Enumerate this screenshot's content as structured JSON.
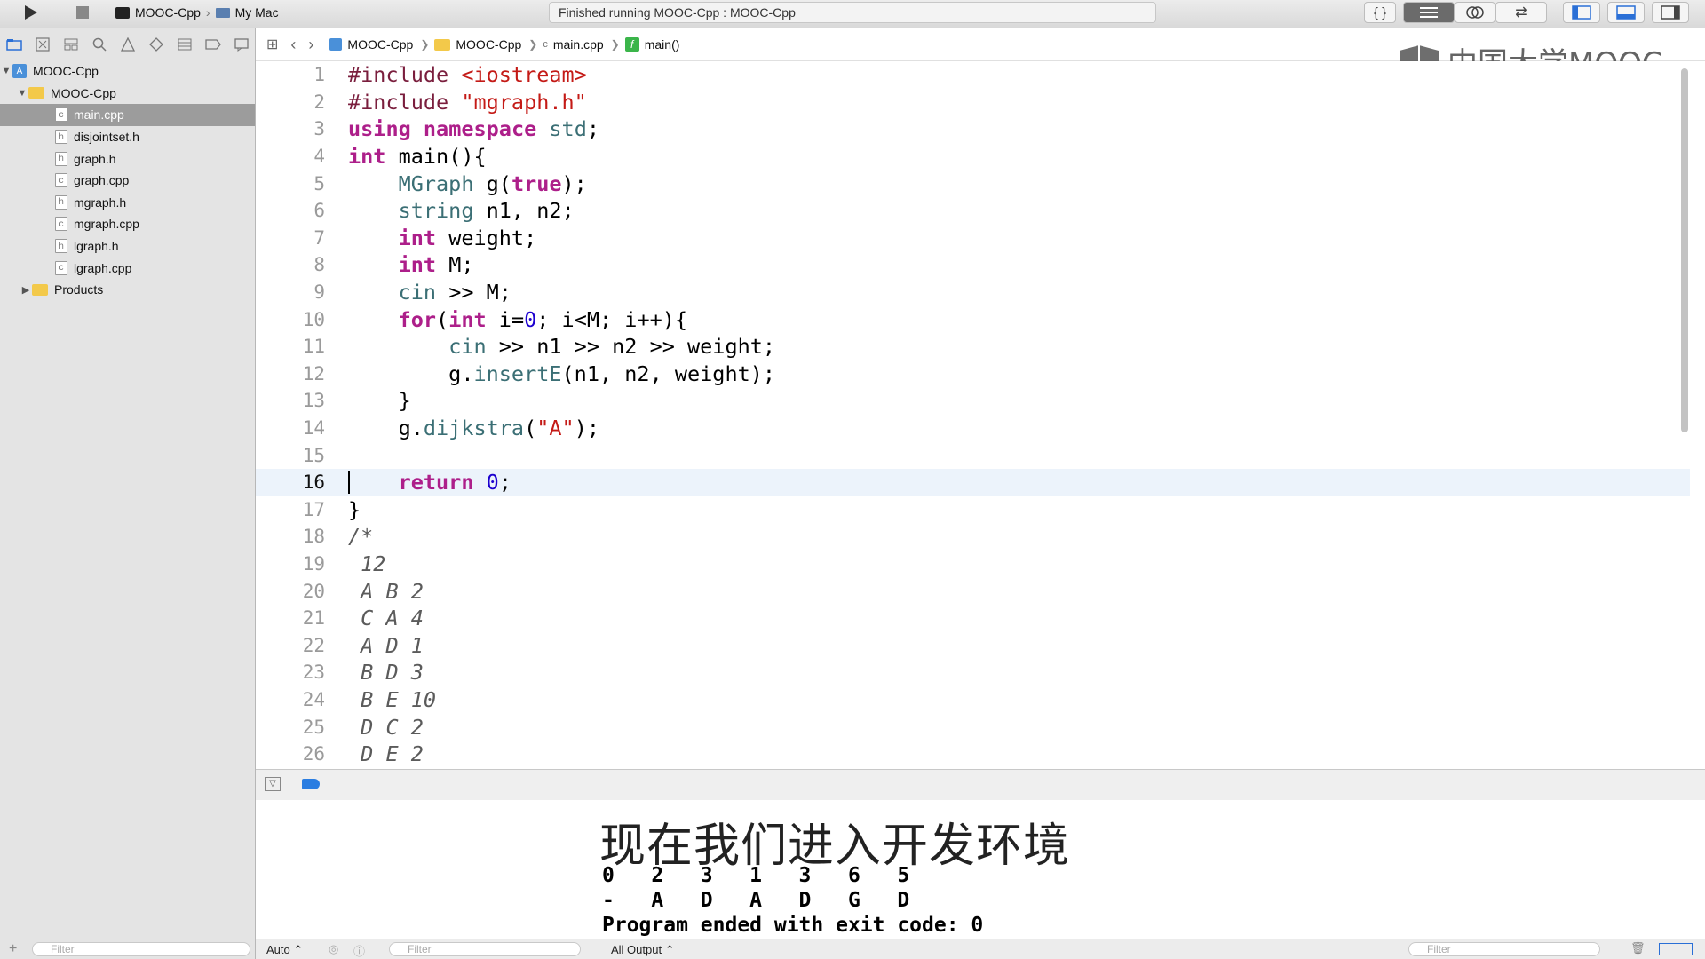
{
  "toolbar": {
    "scheme_target": "MOOC-Cpp",
    "scheme_device": "My Mac",
    "status_text": "Finished running MOOC-Cpp : MOOC-Cpp"
  },
  "watermark": {
    "brand": "中国大学MOOC"
  },
  "navigator": {
    "project": "MOOC-Cpp",
    "group": "MOOC-Cpp",
    "files": [
      {
        "name": "main.cpp",
        "kind": "c",
        "selected": true
      },
      {
        "name": "disjointset.h",
        "kind": "h"
      },
      {
        "name": "graph.h",
        "kind": "h"
      },
      {
        "name": "graph.cpp",
        "kind": "c"
      },
      {
        "name": "mgraph.h",
        "kind": "h"
      },
      {
        "name": "mgraph.cpp",
        "kind": "c"
      },
      {
        "name": "lgraph.h",
        "kind": "h"
      },
      {
        "name": "lgraph.cpp",
        "kind": "c"
      }
    ],
    "products": "Products",
    "filter_placeholder": "Filter"
  },
  "jumpbar": {
    "items": [
      "MOOC-Cpp",
      "MOOC-Cpp",
      "main.cpp",
      "main()"
    ]
  },
  "editor": {
    "current_line": 16,
    "lines": [
      {
        "n": "1",
        "src": "#include <iostream>"
      },
      {
        "n": "2",
        "src": "#include \"mgraph.h\""
      },
      {
        "n": "3",
        "src": "using namespace std;"
      },
      {
        "n": "4",
        "src": "int main(){"
      },
      {
        "n": "5",
        "src": "    MGraph g(true);"
      },
      {
        "n": "6",
        "src": "    string n1, n2;"
      },
      {
        "n": "7",
        "src": "    int weight;"
      },
      {
        "n": "8",
        "src": "    int M;"
      },
      {
        "n": "9",
        "src": "    cin >> M;"
      },
      {
        "n": "10",
        "src": "    for(int i=0; i<M; i++){"
      },
      {
        "n": "11",
        "src": "        cin >> n1 >> n2 >> weight;"
      },
      {
        "n": "12",
        "src": "        g.insertE(n1, n2, weight);"
      },
      {
        "n": "13",
        "src": "    }"
      },
      {
        "n": "14",
        "src": "    g.dijkstra(\"A\");"
      },
      {
        "n": "15",
        "src": ""
      },
      {
        "n": "16",
        "src": "    return 0;"
      },
      {
        "n": "17",
        "src": "}"
      },
      {
        "n": "18",
        "src": "/*"
      },
      {
        "n": "19",
        "src": " 12"
      },
      {
        "n": "20",
        "src": " A B 2"
      },
      {
        "n": "21",
        "src": " C A 4"
      },
      {
        "n": "22",
        "src": " A D 1"
      },
      {
        "n": "23",
        "src": " B D 3"
      },
      {
        "n": "24",
        "src": " B E 10"
      },
      {
        "n": "25",
        "src": " D C 2"
      },
      {
        "n": "26",
        "src": " D E 2"
      }
    ]
  },
  "console": {
    "row1": "0   2   3   1   3   6   5",
    "row2": "-   A   D   A   D   G   D",
    "row3": "Program ended with exit code: 0",
    "subtitle": "现在我们进入开发环境"
  },
  "bottom": {
    "auto_label": "Auto ⌃",
    "filter_placeholder": "Filter",
    "output_select": "All Output ⌃",
    "filter2_placeholder": "Filter"
  }
}
